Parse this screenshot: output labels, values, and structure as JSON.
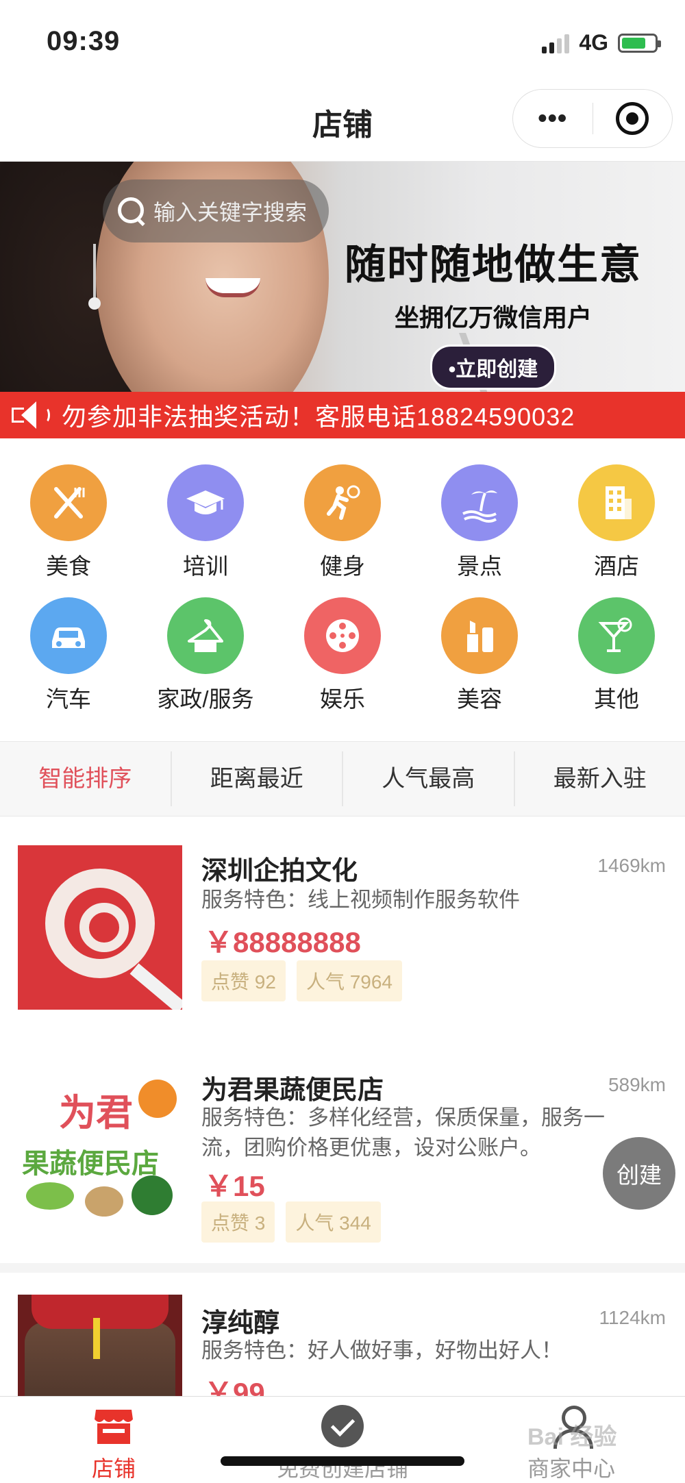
{
  "status_bar": {
    "time": "09:39",
    "network": "4G"
  },
  "nav": {
    "title": "店铺",
    "more": "•••"
  },
  "banner": {
    "search_placeholder": "输入关键字搜索",
    "headline": "随时随地做生意",
    "subline": "坐拥亿万微信用户",
    "cta": "•立即创建"
  },
  "notice": {
    "text": "勿参加非法抽奖活动！客服电话18824590032"
  },
  "categories": [
    {
      "label": "美食",
      "icon": "fork-knife-icon",
      "color": "#f0a040"
    },
    {
      "label": "培训",
      "icon": "graduation-cap-icon",
      "color": "#8f8ef0"
    },
    {
      "label": "健身",
      "icon": "runner-icon",
      "color": "#f0a040"
    },
    {
      "label": "景点",
      "icon": "island-icon",
      "color": "#8f8ef0"
    },
    {
      "label": "酒店",
      "icon": "building-icon",
      "color": "#f5c844"
    },
    {
      "label": "汽车",
      "icon": "car-icon",
      "color": "#5ca8f0"
    },
    {
      "label": "家政/服务",
      "icon": "hanger-icon",
      "color": "#5cc46a"
    },
    {
      "label": "娱乐",
      "icon": "film-reel-icon",
      "color": "#ef6464"
    },
    {
      "label": "美容",
      "icon": "lipstick-icon",
      "color": "#f0a040"
    },
    {
      "label": "其他",
      "icon": "cocktail-icon",
      "color": "#5cc46a"
    }
  ],
  "sort_tabs": [
    "智能排序",
    "距离最近",
    "人气最高",
    "最新入驻"
  ],
  "stores": [
    {
      "name": "深圳企拍文化",
      "distance": "1469km",
      "desc": "服务特色：线上视频制作服务软件",
      "price": "￥88888888",
      "likes": "点赞 92",
      "popularity": "人气 7964"
    },
    {
      "name": "为君果蔬便民店",
      "distance": "589km",
      "desc": "服务特色：多样化经营，保质保量，服务一流，团购价格更优惠，设对公账户。",
      "price": "￥15",
      "likes": "点赞 3",
      "popularity": "人气 344",
      "thumb_text_1": "为君",
      "thumb_text_2": "果蔬便民店"
    },
    {
      "name": "淳纯醇",
      "distance": "1124km",
      "desc": "服务特色：好人做好事，好物出好人！",
      "price": "￥99"
    }
  ],
  "fab": {
    "label": "创建"
  },
  "tab_bar": [
    {
      "label": "店铺",
      "icon": "store-icon"
    },
    {
      "label": "免费创建店铺",
      "icon": "check-circle-icon"
    },
    {
      "label": "商家中心",
      "icon": "user-icon"
    }
  ],
  "watermark": "Bai 经验",
  "colors": {
    "accent": "#e8332b",
    "price": "#e0505a",
    "tag_bg": "#fdf3dd"
  }
}
